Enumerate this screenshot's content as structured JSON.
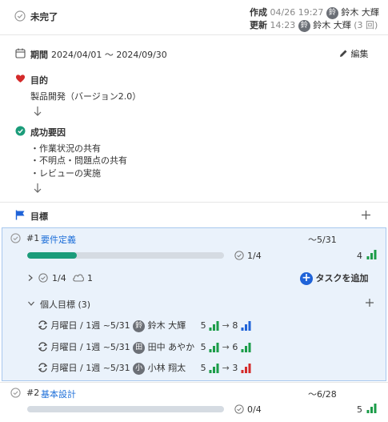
{
  "status": {
    "label": "未完了"
  },
  "meta": {
    "created_label": "作成",
    "created_time": "04/26 19:27",
    "created_avatar": "鈴",
    "created_user": "鈴木 大輝",
    "updated_label": "更新",
    "updated_time": "14:23",
    "updated_avatar": "鈴",
    "updated_user": "鈴木 大輝",
    "updated_count": "(3 回)"
  },
  "period": {
    "label": "期間",
    "value": "2024/04/01 〜 2024/09/30",
    "edit_label": "編集"
  },
  "purpose": {
    "label": "目的",
    "text": "製品開発（バージョン2.0）"
  },
  "success_factors": {
    "label": "成功要因",
    "items": [
      "・作業状況の共有",
      "・不明点・問題点の共有",
      "・レビューの実施"
    ]
  },
  "goals": {
    "label": "目標",
    "items": [
      {
        "number": "#1",
        "title": "要件定義",
        "due": "〜5/31",
        "progress": 0.25,
        "task_count": "1/4",
        "score": "4",
        "subtask_count": "1/4",
        "cloud_count": "1",
        "add_task_label": "タスクを追加",
        "personal_label": "個人目標 (3)",
        "personal": [
          {
            "schedule": "月曜日 / 1週 ~5/31",
            "avatar": "鈴",
            "name": "鈴木 大輝",
            "from": "5",
            "to": "8",
            "to_color": "#1f63d8"
          },
          {
            "schedule": "月曜日 / 1週 ~5/31",
            "avatar": "田",
            "name": "田中 あやか",
            "from": "5",
            "to": "6",
            "to_color": "#1b9c48"
          },
          {
            "schedule": "月曜日 / 1週 ~5/31",
            "avatar": "小",
            "name": "小林 翔太",
            "from": "5",
            "to": "3",
            "to_color": "#d42a2a"
          }
        ]
      },
      {
        "number": "#2",
        "title": "基本設計",
        "due": "〜6/28",
        "progress": 0,
        "task_count": "0/4",
        "score": "5"
      }
    ]
  },
  "colors": {
    "accent": "#1f63d8",
    "green": "#1b9c48",
    "red": "#d42a2a",
    "teal": "#1b9c7a"
  }
}
